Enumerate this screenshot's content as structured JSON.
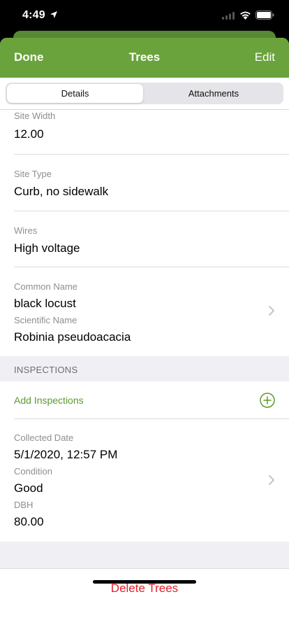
{
  "status": {
    "time": "4:49"
  },
  "nav": {
    "done": "Done",
    "title": "Trees",
    "edit": "Edit"
  },
  "tabs": {
    "details": "Details",
    "attachments": "Attachments"
  },
  "fields": {
    "site_width": {
      "label": "Site Width",
      "value": "12.00"
    },
    "site_type": {
      "label": "Site Type",
      "value": "Curb, no sidewalk"
    },
    "wires": {
      "label": "Wires",
      "value": "High voltage"
    },
    "common_name": {
      "label": "Common Name",
      "value": "black locust"
    },
    "scientific_name": {
      "label": "Scientific Name",
      "value": "Robinia pseudoacacia"
    }
  },
  "inspections": {
    "header": "INSPECTIONS",
    "add_label": "Add Inspections",
    "record": {
      "collected_label": "Collected Date",
      "collected_value": "5/1/2020, 12:57 PM",
      "condition_label": "Condition",
      "condition_value": "Good",
      "dbh_label": "DBH",
      "dbh_value": "80.00"
    }
  },
  "delete_label": "Delete Trees",
  "colors": {
    "accent": "#6aa23c",
    "destructive": "#e0202a"
  },
  "icons": [
    "location-arrow-icon",
    "signal-icon",
    "wifi-icon",
    "battery-icon",
    "chevron-right-icon",
    "add-circle-icon"
  ]
}
